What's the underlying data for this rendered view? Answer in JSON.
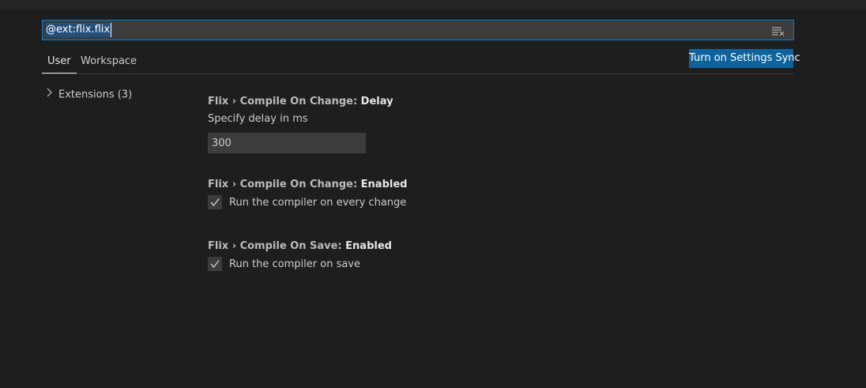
{
  "search": {
    "value": "@ext:flix.flix",
    "clear_icon": "clear-filter-icon"
  },
  "tabs": [
    {
      "label": "User",
      "active": true
    },
    {
      "label": "Workspace",
      "active": false
    }
  ],
  "sync_button_label": "Turn on Settings Sync",
  "toc": {
    "items": [
      {
        "label": "Extensions (3)",
        "icon": "chevron-right-icon",
        "expanded": false
      }
    ]
  },
  "settings": [
    {
      "category": "Flix › Compile On Change: ",
      "key": "Delay",
      "description": "Specify delay in ms",
      "value": "300"
    },
    {
      "category": "Flix › Compile On Change: ",
      "key": "Enabled",
      "checked": true,
      "label": "Run the compiler on every change"
    },
    {
      "category": "Flix › Compile On Save: ",
      "key": "Enabled",
      "checked": true,
      "label": "Run the compiler on save"
    }
  ],
  "colors": {
    "background": "#1e1e1e",
    "accent": "#007fd4",
    "button": "#0e639c",
    "input": "#3c3c3c"
  }
}
